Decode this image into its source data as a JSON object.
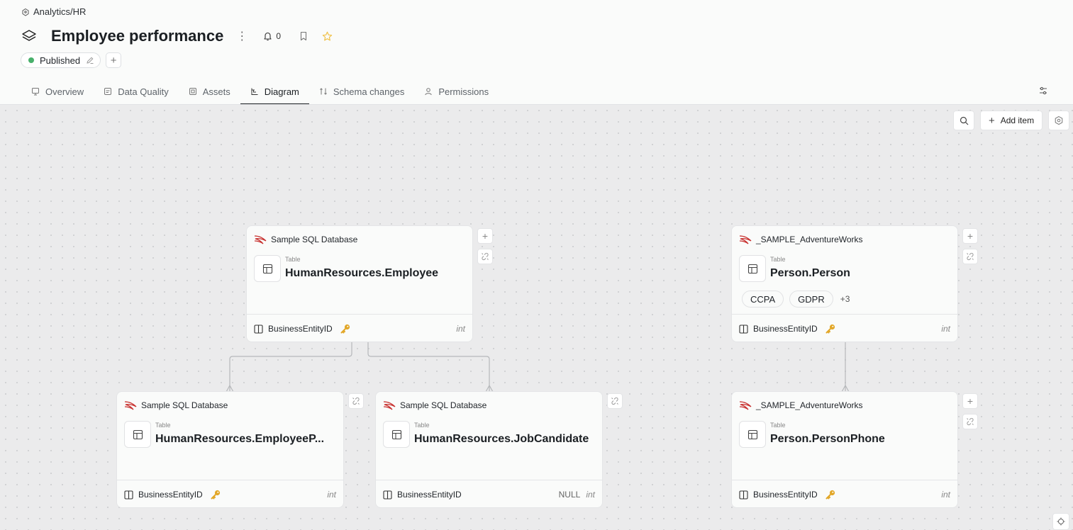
{
  "breadcrumb": "Analytics/HR",
  "title": "Employee performance",
  "notifications_count": "0",
  "status": {
    "label": "Published",
    "color": "#48b06b"
  },
  "tabs": [
    {
      "label": "Overview",
      "icon": "monitor-icon"
    },
    {
      "label": "Data Quality",
      "icon": "quality-icon"
    },
    {
      "label": "Assets",
      "icon": "assets-icon"
    },
    {
      "label": "Diagram",
      "icon": "diagram-icon",
      "active": true
    },
    {
      "label": "Schema changes",
      "icon": "schema-changes-icon"
    },
    {
      "label": "Permissions",
      "icon": "user-icon"
    }
  ],
  "toolbar": {
    "add_item": "Add item"
  },
  "cards": [
    {
      "id": "employee",
      "source": "Sample SQL Database",
      "type_label": "Table",
      "name": "HumanResources.Employee",
      "tags": [],
      "more": "",
      "field": {
        "name": "BusinessEntityID",
        "key": true,
        "null": "",
        "type": "int"
      }
    },
    {
      "id": "person",
      "source": "_SAMPLE_AdventureWorks",
      "type_label": "Table",
      "name": "Person.Person",
      "tags": [
        "CCPA",
        "GDPR"
      ],
      "more": "+3",
      "field": {
        "name": "BusinessEntityID",
        "key": true,
        "null": "",
        "type": "int"
      }
    },
    {
      "id": "employee-p",
      "source": "Sample SQL Database",
      "type_label": "Table",
      "name": "HumanResources.EmployeeP...",
      "tags": [],
      "more": "",
      "field": {
        "name": "BusinessEntityID",
        "key": true,
        "null": "",
        "type": "int"
      }
    },
    {
      "id": "job-candidate",
      "source": "Sample SQL Database",
      "type_label": "Table",
      "name": "HumanResources.JobCandidate",
      "tags": [],
      "more": "",
      "field": {
        "name": "BusinessEntityID",
        "key": false,
        "null": "NULL",
        "type": "int"
      }
    },
    {
      "id": "person-phone",
      "source": "_SAMPLE_AdventureWorks",
      "type_label": "Table",
      "name": "Person.PersonPhone",
      "tags": [],
      "more": "",
      "field": {
        "name": "BusinessEntityID",
        "key": true,
        "null": "",
        "type": "int"
      }
    }
  ],
  "colors": {
    "accent": "#1b1f23",
    "star": "#f0c24a",
    "key": "#e2a728",
    "source_logo": "#c8312f"
  }
}
